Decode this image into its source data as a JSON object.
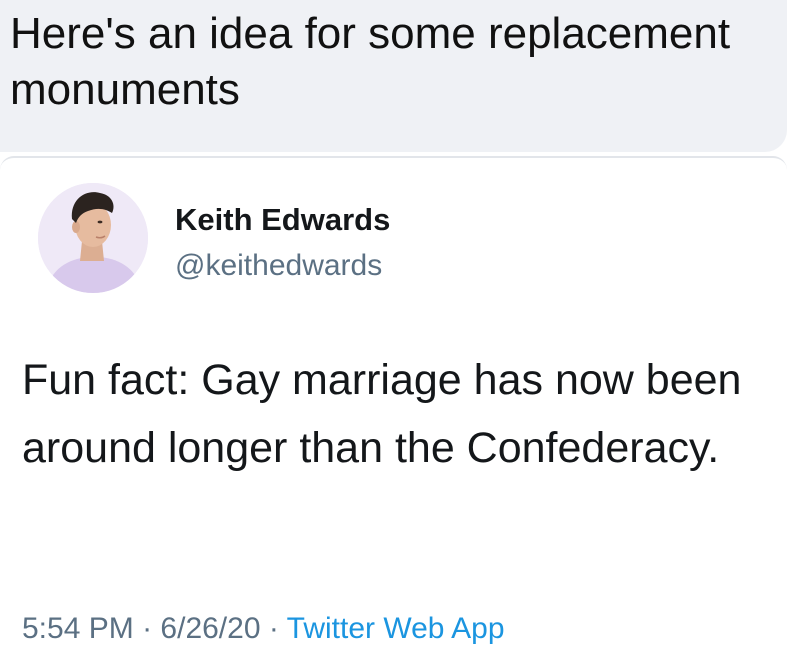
{
  "post": {
    "text": "Here's an idea for some replacement monuments"
  },
  "tweet": {
    "author": {
      "name": "Keith Edwards",
      "handle": "@keithedwards",
      "avatar_icon": "profile-photo"
    },
    "body": "Fun fact: Gay marriage has now been around longer than the Confederacy.",
    "time": "5:54 PM",
    "separator": "·",
    "date": "6/26/20",
    "source": "Twitter Web App"
  },
  "colors": {
    "post_bubble": "#eff1f5",
    "text_primary": "#14171a",
    "text_secondary": "#5b7083",
    "link": "#1b95e0"
  }
}
